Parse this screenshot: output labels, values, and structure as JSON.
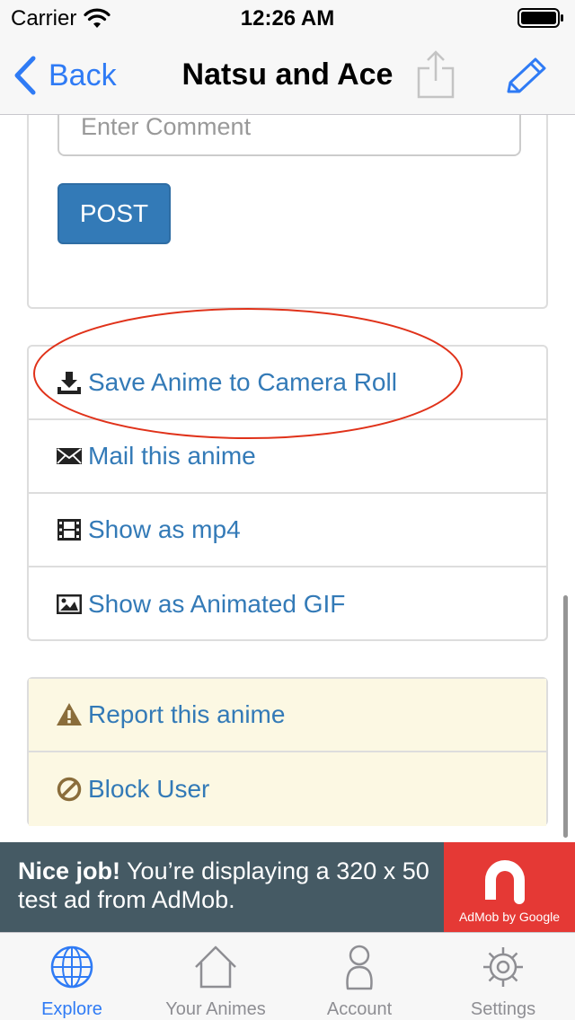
{
  "status_bar": {
    "carrier": "Carrier",
    "time": "12:26 AM"
  },
  "nav": {
    "back_label": "Back",
    "title": "Natsu and Ace",
    "accent_color": "#2f7bf5"
  },
  "comment": {
    "placeholder": "Enter Comment",
    "post_label": "POST"
  },
  "actions": [
    {
      "icon": "download-icon",
      "label": "Save Anime to Camera Roll"
    },
    {
      "icon": "envelope-icon",
      "label": "Mail this anime"
    },
    {
      "icon": "film-icon",
      "label": "Show as mp4"
    },
    {
      "icon": "picture-icon",
      "label": "Show as Animated GIF"
    }
  ],
  "warnings": [
    {
      "icon": "warning-icon",
      "label": "Report this anime"
    },
    {
      "icon": "ban-icon",
      "label": "Block User"
    }
  ],
  "ad": {
    "headline": "Nice job!",
    "body": " You’re displaying a 320 x 50 test ad from AdMob.",
    "logo_caption": "AdMob by Google",
    "background_color": "#455a64",
    "logo_color": "#e53935"
  },
  "tabs": [
    {
      "label": "Explore",
      "icon": "globe-icon",
      "active": true
    },
    {
      "label": "Your Animes",
      "icon": "house-icon",
      "active": false
    },
    {
      "label": "Account",
      "icon": "person-icon",
      "active": false
    },
    {
      "label": "Settings",
      "icon": "gear-icon",
      "active": false
    }
  ]
}
